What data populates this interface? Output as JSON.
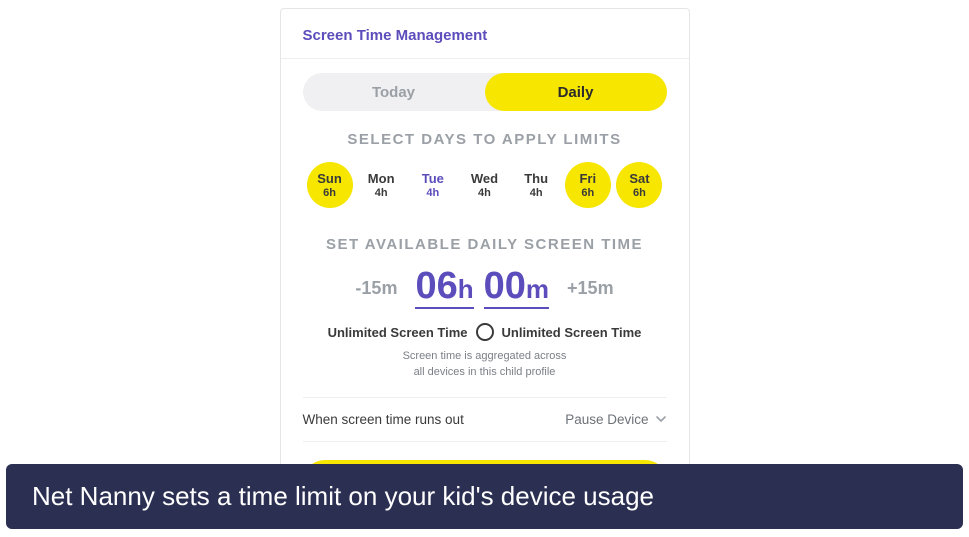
{
  "header": {
    "title": "Screen Time Management"
  },
  "tabs": {
    "today": "Today",
    "daily": "Daily"
  },
  "select_days_title": "SELECT DAYS TO APPLY LIMITS",
  "days": [
    {
      "label": "Sun",
      "hours": "6h",
      "selected": true,
      "accent": false
    },
    {
      "label": "Mon",
      "hours": "4h",
      "selected": false,
      "accent": false
    },
    {
      "label": "Tue",
      "hours": "4h",
      "selected": false,
      "accent": true
    },
    {
      "label": "Wed",
      "hours": "4h",
      "selected": false,
      "accent": false
    },
    {
      "label": "Thu",
      "hours": "4h",
      "selected": false,
      "accent": false
    },
    {
      "label": "Fri",
      "hours": "6h",
      "selected": true,
      "accent": false
    },
    {
      "label": "Sat",
      "hours": "6h",
      "selected": true,
      "accent": false
    }
  ],
  "set_time_title": "SET AVAILABLE DAILY SCREEN TIME",
  "adjust": {
    "dec": "-15m",
    "inc": "+15m"
  },
  "time": {
    "h_num": "06",
    "h_unit": "h",
    "m_num": "00",
    "m_unit": "m"
  },
  "unlimited": {
    "left": "Unlimited Screen Time",
    "right": "Unlimited Screen Time"
  },
  "note_line1": "Screen time is aggregated across",
  "note_line2": "all devices in this child profile",
  "runout": {
    "label": "When screen time runs out",
    "value": "Pause Device"
  },
  "caption": "Net Nanny sets a time limit on your kid's device usage"
}
